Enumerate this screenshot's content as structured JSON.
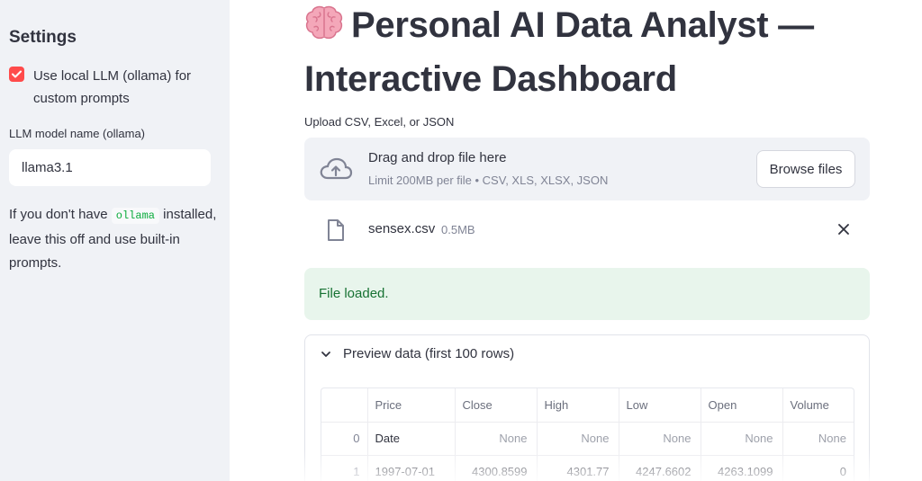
{
  "sidebar": {
    "title": "Settings",
    "checkbox_label": "Use local LLM (ollama) for custom prompts",
    "checkbox_checked": true,
    "model_field_label": "LLM model name (ollama)",
    "model_field_value": "llama3.1",
    "note_before": "If you don't have ",
    "note_code": "ollama",
    "note_after": " installed, leave this off and use built-in prompts."
  },
  "main": {
    "title": "Personal AI Data Analyst — Interactive Dashboard",
    "title_icon": "brain-emoji",
    "uploader": {
      "label": "Upload CSV, Excel, or JSON",
      "drag_text": "Drag and drop file here",
      "limit_text": "Limit 200MB per file • CSV, XLS, XLSX, JSON",
      "browse_label": "Browse files",
      "icon": "cloud-upload-icon"
    },
    "uploaded_file": {
      "name": "sensex.csv",
      "size": "0.5MB",
      "icon": "file-icon"
    },
    "success_message": "File loaded.",
    "success_color": "#177233",
    "preview": {
      "title": "Preview data (first 100 rows)",
      "columns": [
        "",
        "Price",
        "Close",
        "High",
        "Low",
        "Open",
        "Volume"
      ],
      "rows": [
        [
          "0",
          "Date",
          "None",
          "None",
          "None",
          "None",
          "None"
        ],
        [
          "1",
          "1997-07-01",
          "4300.8599",
          "4301.77",
          "4247.6602",
          "4263.1099",
          "0"
        ]
      ]
    }
  },
  "colors": {
    "accent": "#ff4b4b",
    "sidebar_bg": "#f0f2f6",
    "text": "#31333f"
  }
}
